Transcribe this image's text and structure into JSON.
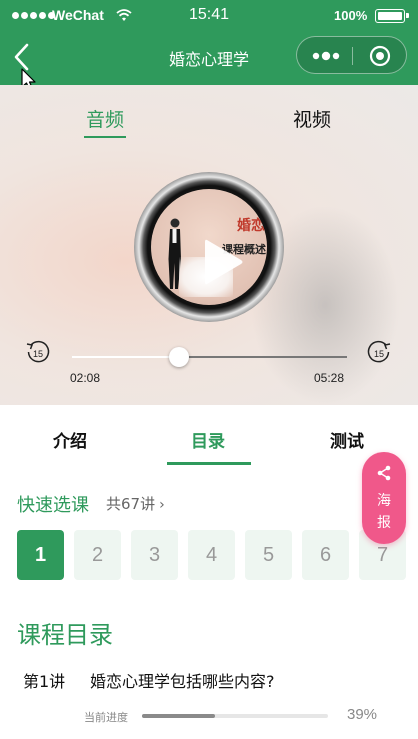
{
  "status_bar": {
    "carrier": "WeChat",
    "time": "15:41",
    "battery": "100%"
  },
  "nav": {
    "title": "婚恋心理学",
    "back_icon": "chevron-left-icon",
    "more_icon": "more-dots-icon",
    "close_icon": "target-close-icon"
  },
  "player": {
    "tabs": [
      {
        "label": "音频",
        "active": true
      },
      {
        "label": "视频",
        "active": false
      }
    ],
    "cover_text_1": "婚恋",
    "cover_text_2": "课程概述",
    "skip_back_label": "15",
    "skip_forward_label": "15",
    "current_time": "02:08",
    "total_time": "05:28",
    "progress_fraction": 0.39
  },
  "content_tabs": [
    {
      "label": "介绍",
      "active": false
    },
    {
      "label": "目录",
      "active": true
    },
    {
      "label": "测试",
      "active": false
    }
  ],
  "quick_select": {
    "title": "快速选课",
    "count": "共67讲",
    "lessons": [
      "1",
      "2",
      "3",
      "4",
      "5",
      "6",
      "7"
    ],
    "active_index": 0
  },
  "poster_button": {
    "line1": "海",
    "line2": "报",
    "icon": "share-icon"
  },
  "directory": {
    "title": "课程目录",
    "items": [
      {
        "number": "第1讲",
        "title": "婚恋心理学包括哪些内容?",
        "progress_label": "当前进度",
        "progress_percent": "39%",
        "progress_fraction": 0.39
      }
    ]
  },
  "colors": {
    "brand_green": "#2f9a5c",
    "poster_pink": "#f0588a",
    "lesson_inactive_bg": "#eef6f1"
  }
}
